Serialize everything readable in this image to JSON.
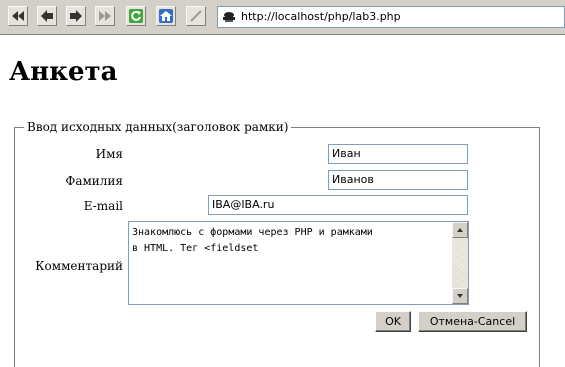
{
  "browser": {
    "address": "http://localhost/php/lab3.php"
  },
  "page": {
    "title": "Анкета"
  },
  "form": {
    "legend": "Ввод исходных данных(заголовок рамки)",
    "fields": {
      "first_name": {
        "label": "Имя",
        "value": "Иван"
      },
      "last_name": {
        "label": "Фамилия",
        "value": "Иванов"
      },
      "email": {
        "label": "E-mail",
        "value": "IBA@IBA.ru"
      },
      "comment": {
        "label": "Комментарий",
        "value": "Знакомлюсь с формами через PHP и рамками\nв HTML. Тег <fieldset"
      }
    },
    "buttons": {
      "ok": "OK",
      "cancel": "Отмена-Cancel"
    }
  }
}
